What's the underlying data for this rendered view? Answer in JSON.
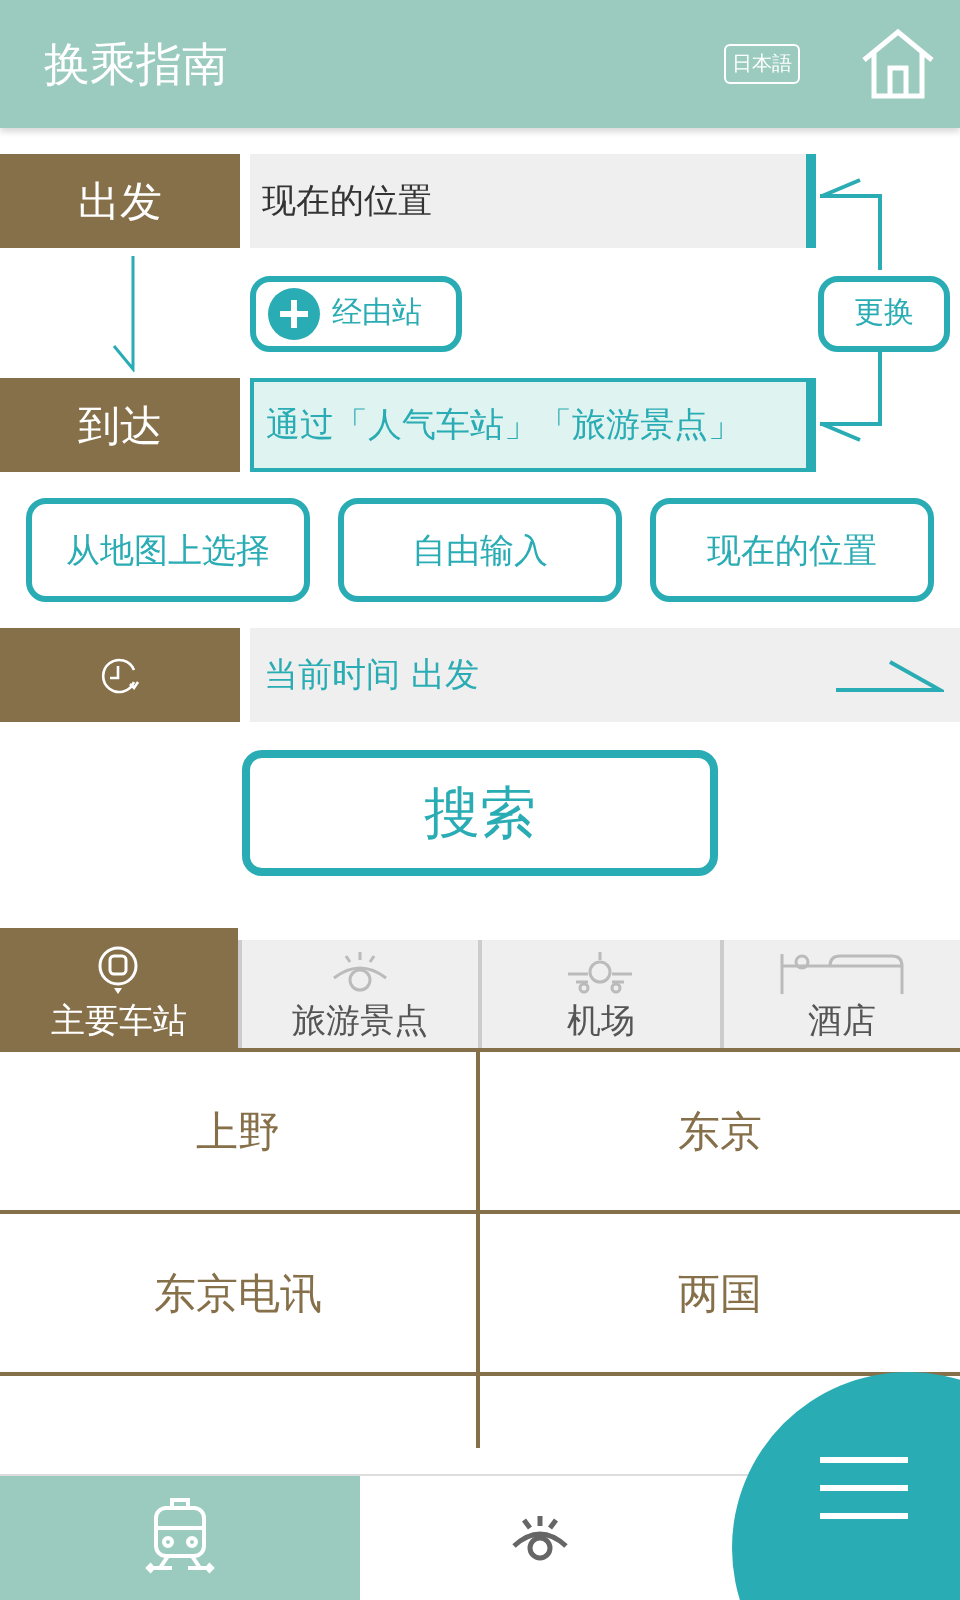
{
  "header": {
    "title": "换乘指南",
    "language_button": "日本語"
  },
  "departure": {
    "label": "出发",
    "value": "现在的位置"
  },
  "via_button": "经由站",
  "swap_button": "更换",
  "arrival": {
    "label": "到达",
    "placeholder": "通过「人气车站」「旅游景点」"
  },
  "choice_buttons": [
    "从地图上选择",
    "自由输入",
    "现在的位置"
  ],
  "time": {
    "value": "当前时间 出发"
  },
  "search_button": "搜索",
  "category_tabs": [
    {
      "label": "主要车站",
      "kind": "station",
      "selected": true
    },
    {
      "label": "旅游景点",
      "kind": "sights",
      "selected": false
    },
    {
      "label": "机场",
      "kind": "airport",
      "selected": false
    },
    {
      "label": "酒店",
      "kind": "hotel",
      "selected": false
    }
  ],
  "stations": [
    "上野",
    "东京",
    "东京电讯",
    "两国"
  ],
  "bottom_nav": [
    {
      "kind": "route",
      "selected": true
    },
    {
      "kind": "sights",
      "selected": false
    }
  ]
}
